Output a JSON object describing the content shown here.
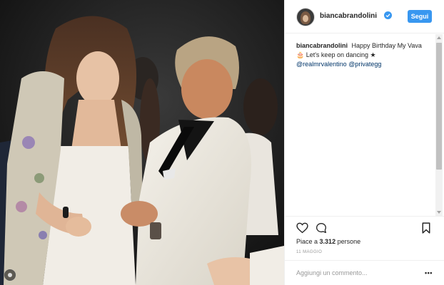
{
  "post": {
    "username": "biancabrandolini",
    "verified": true,
    "follow_label": "Segui",
    "caption": {
      "author": "biancabrandolini",
      "line1": "Happy Birthday My Vava",
      "line2": "🎂 Let's keep on dancing ★",
      "mentions": [
        "@realmrvalentino",
        "@privategg"
      ]
    },
    "likes_prefix": "Piace a",
    "likes_count": "3.312",
    "likes_suffix": "persone",
    "date": "11 MAGGIO",
    "comment_placeholder": "Aggiungi un commento...",
    "more_label": "•••"
  },
  "icons": {
    "verified": "verified-badge-icon",
    "like": "heart-icon",
    "comment": "comment-icon",
    "save": "bookmark-icon",
    "more": "more-options-icon"
  },
  "colors": {
    "accent": "#3897f0",
    "mention": "#003569",
    "muted": "#999999",
    "border": "#efefef"
  }
}
